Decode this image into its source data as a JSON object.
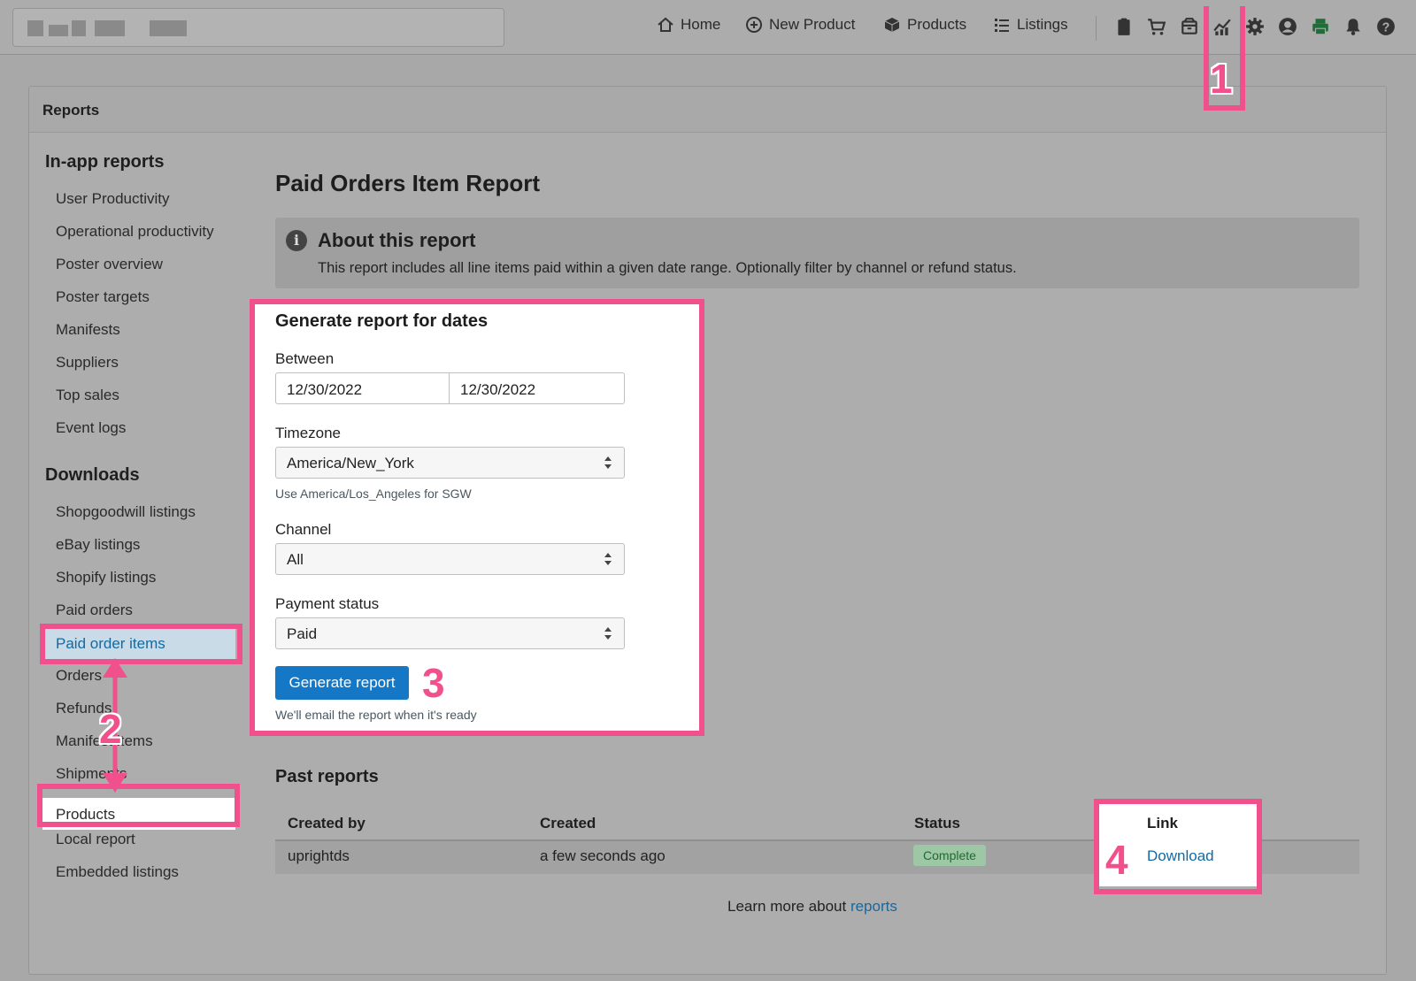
{
  "topnav": {
    "home": "Home",
    "new_product": "New Product",
    "products": "Products",
    "listings": "Listings"
  },
  "icons": [
    "clipboard-icon",
    "cart-icon",
    "box-icon",
    "reports-chart-icon",
    "gear-icon",
    "user-icon",
    "printer-icon",
    "bell-icon",
    "help-icon"
  ],
  "panel": {
    "title": "Reports"
  },
  "sidebar": {
    "inapp_title": "In-app reports",
    "inapp": [
      "User Productivity",
      "Operational productivity",
      "Poster overview",
      "Poster targets",
      "Manifests",
      "Suppliers",
      "Top sales",
      "Event logs"
    ],
    "downloads_title": "Downloads",
    "downloads": [
      "Shopgoodwill listings",
      "eBay listings",
      "Shopify listings",
      "Paid orders",
      "Paid order items",
      "Orders",
      "Refunds",
      "Manifest items",
      "Shipments",
      "Products",
      "Local report",
      "Embedded listings"
    ],
    "active": "Paid order items"
  },
  "main": {
    "title": "Paid Orders Item Report",
    "about_title": "About this report",
    "about_text": "This report includes all line items paid within a given date range. Optionally filter by channel or refund status."
  },
  "form": {
    "heading": "Generate report for dates",
    "between_label": "Between",
    "date_from": "12/30/2022",
    "date_to": "12/30/2022",
    "timezone_label": "Timezone",
    "timezone_value": "America/New_York",
    "timezone_hint": "Use America/Los_Angeles for SGW",
    "channel_label": "Channel",
    "channel_value": "All",
    "payment_label": "Payment status",
    "payment_value": "Paid",
    "generate_button": "Generate report",
    "email_hint": "We'll email the report when it's ready"
  },
  "past_reports": {
    "title": "Past reports",
    "columns": [
      "Created by",
      "Created",
      "Status",
      "Link"
    ],
    "rows": [
      {
        "created_by": "uprightds",
        "created": "a few seconds ago",
        "status": "Complete",
        "link": "Download"
      }
    ]
  },
  "footer": {
    "learn_prefix": "Learn more about",
    "learn_link": "reports"
  },
  "annotations": [
    "1",
    "2",
    "3",
    "4"
  ],
  "colors": {
    "annotation": "#f0508c",
    "primary": "#1478c6",
    "link": "#136aa3",
    "success_badge": "#9ec7a5"
  }
}
